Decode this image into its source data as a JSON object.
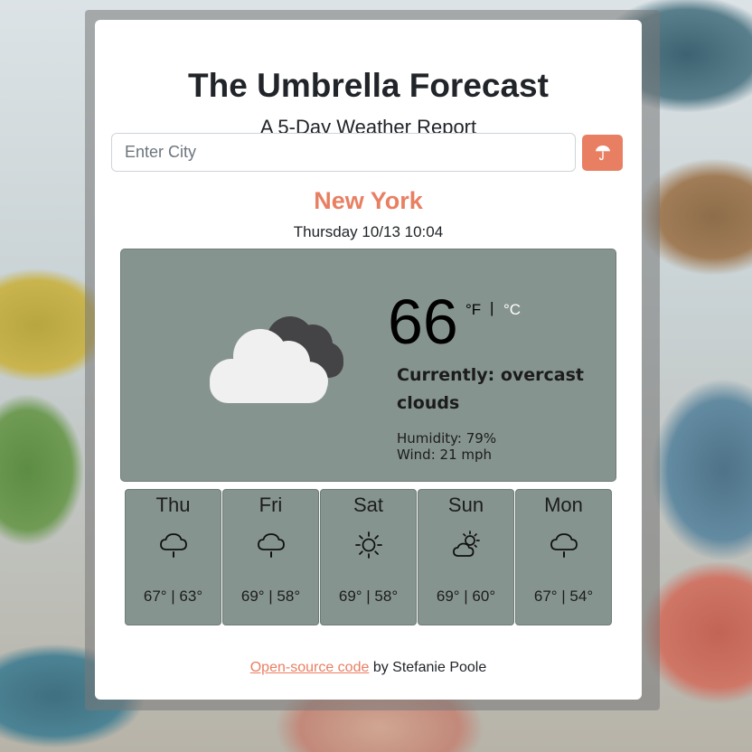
{
  "header": {
    "title": "The Umbrella Forecast",
    "subtitle": "A 5-Day Weather Report"
  },
  "search": {
    "placeholder": "Enter City",
    "value": "",
    "button_icon": "umbrella-icon"
  },
  "current": {
    "city": "New York",
    "datetime": "Thursday 10/13 10:04",
    "icon": "broken-clouds-icon",
    "temperature": "66",
    "unit_f": "°F",
    "unit_separator": "|",
    "unit_c": "°C",
    "description": "Currently: overcast clouds",
    "humidity": "Humidity: 79%",
    "wind": "Wind: 21 mph"
  },
  "forecast": [
    {
      "day": "Thu",
      "icon": "rain-cloud-icon",
      "temps": "67° | 63°"
    },
    {
      "day": "Fri",
      "icon": "rain-cloud-icon",
      "temps": "69° | 58°"
    },
    {
      "day": "Sat",
      "icon": "sun-icon",
      "temps": "69° | 58°"
    },
    {
      "day": "Sun",
      "icon": "partly-cloudy-icon",
      "temps": "69° | 60°"
    },
    {
      "day": "Mon",
      "icon": "rain-cloud-icon",
      "temps": "67° | 54°"
    }
  ],
  "footer": {
    "link_text": "Open-source code",
    "suffix": " by Stefanie Poole"
  },
  "colors": {
    "accent": "#e97f62",
    "panel": "#869490",
    "card": "#ffffff"
  }
}
